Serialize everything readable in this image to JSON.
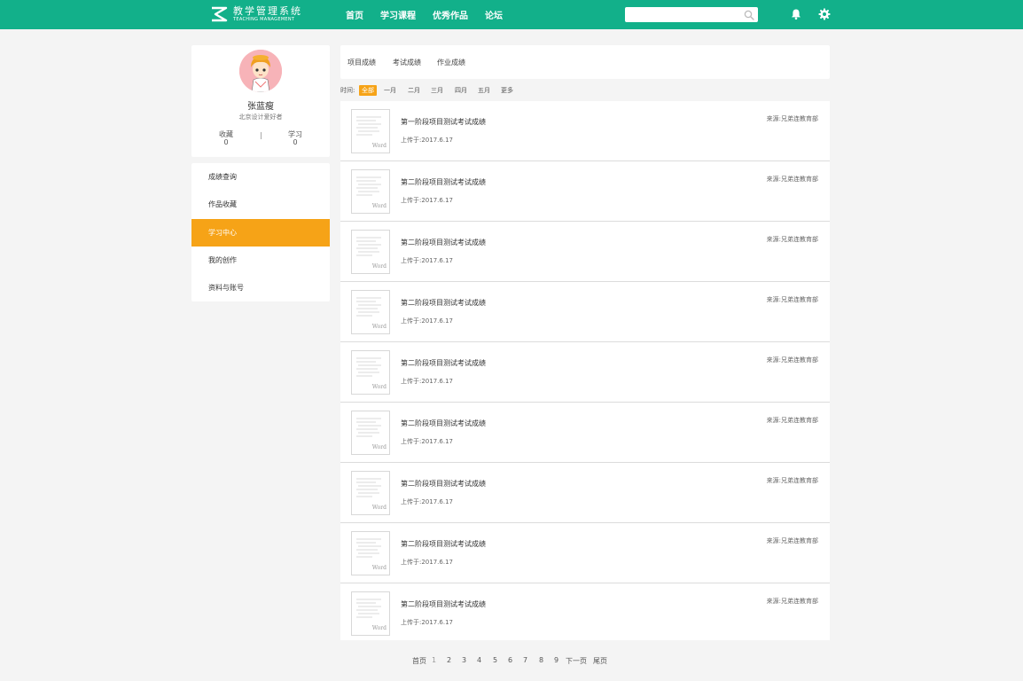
{
  "brand": {
    "name_cn": "教学管理系统",
    "name_en": "TEACHING MANAGEMENT"
  },
  "nav": {
    "items": [
      "首页",
      "学习课程",
      "优秀作品",
      "论坛"
    ]
  },
  "search": {
    "placeholder": "",
    "icon": "search-icon"
  },
  "header_icons": [
    "bell-icon",
    "gear-icon"
  ],
  "profile": {
    "name": "张蓝瘦",
    "subtitle": "北京设计爱好者",
    "stats": [
      {
        "label": "收藏",
        "value": "0"
      },
      {
        "label": "学习",
        "value": "0"
      }
    ]
  },
  "menu": {
    "items": [
      "成绩查询",
      "作品收藏",
      "学习中心",
      "我的创作",
      "资料与账号"
    ],
    "active_index": 2
  },
  "tabs": [
    "项目成绩",
    "考试成绩",
    "作业成绩"
  ],
  "filters": {
    "label": "时间:",
    "options": [
      "全部",
      "一月",
      "二月",
      "三月",
      "四月",
      "五月",
      "更多"
    ],
    "active_index": 0
  },
  "list": [
    {
      "title": "第一阶段项目测试考试成绩",
      "date": "上传于:2017.6.17",
      "source": "来源:兄弟连教育部",
      "thumb": "Word"
    },
    {
      "title": "第二阶段项目测试考试成绩",
      "date": "上传于:2017.6.17",
      "source": "来源:兄弟连教育部",
      "thumb": "Word"
    },
    {
      "title": "第二阶段项目测试考试成绩",
      "date": "上传于:2017.6.17",
      "source": "来源:兄弟连教育部",
      "thumb": "Word"
    },
    {
      "title": "第二阶段项目测试考试成绩",
      "date": "上传于:2017.6.17",
      "source": "来源:兄弟连教育部",
      "thumb": "Word"
    },
    {
      "title": "第二阶段项目测试考试成绩",
      "date": "上传于:2017.6.17",
      "source": "来源:兄弟连教育部",
      "thumb": "Word"
    },
    {
      "title": "第二阶段项目测试考试成绩",
      "date": "上传于:2017.6.17",
      "source": "来源:兄弟连教育部",
      "thumb": "Word"
    },
    {
      "title": "第二阶段项目测试考试成绩",
      "date": "上传于:2017.6.17",
      "source": "来源:兄弟连教育部",
      "thumb": "Word"
    },
    {
      "title": "第二阶段项目测试考试成绩",
      "date": "上传于:2017.6.17",
      "source": "来源:兄弟连教育部",
      "thumb": "Word"
    },
    {
      "title": "第二阶段项目测试考试成绩",
      "date": "上传于:2017.6.17",
      "source": "来源:兄弟连教育部",
      "thumb": "Word"
    }
  ],
  "pagination": {
    "first": "首页",
    "pages": [
      "1",
      "2",
      "3",
      "4",
      "5",
      "6",
      "7",
      "8",
      "9"
    ],
    "current": "1",
    "next": "下一页",
    "last": "尾页"
  },
  "colors": {
    "header": "#12b08a",
    "accent": "#f6a317",
    "background": "#f4f4f4"
  }
}
